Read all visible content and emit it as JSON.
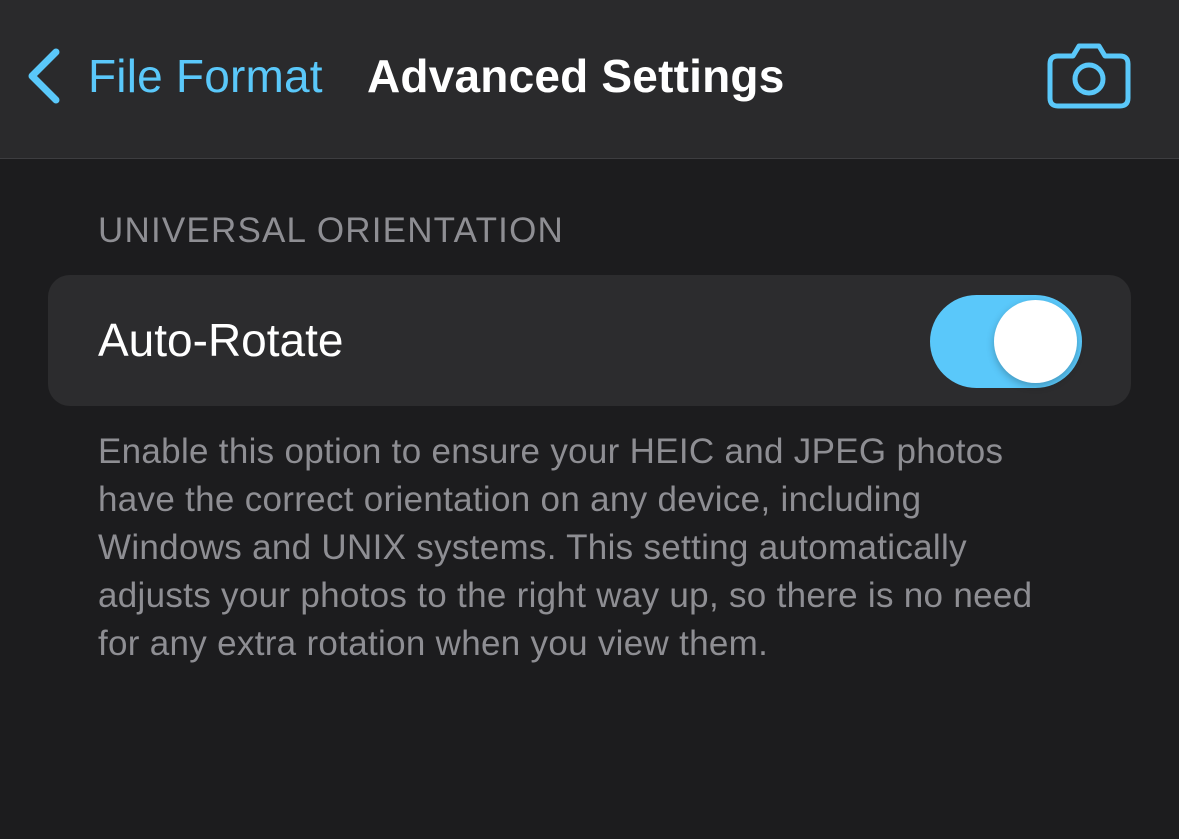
{
  "navbar": {
    "back_label": "File Format",
    "title": "Advanced Settings",
    "back_icon": "chevron-left-icon",
    "action_icon": "camera-icon"
  },
  "section": {
    "header": "UNIVERSAL ORIENTATION",
    "row": {
      "label": "Auto-Rotate",
      "toggle_on": true
    },
    "footer": "Enable this option to ensure your HEIC and JPEG photos have the correct orientation on any device, including Windows and UNIX systems. This setting automatically adjusts your photos to the right way up, so there is no need for any extra rotation when you view them."
  },
  "colors": {
    "accent": "#5ac8fa",
    "background": "#1c1c1e",
    "navbar_background": "#2a2a2c",
    "cell_background": "#2c2c2e",
    "secondary_text": "#8e8e93"
  }
}
